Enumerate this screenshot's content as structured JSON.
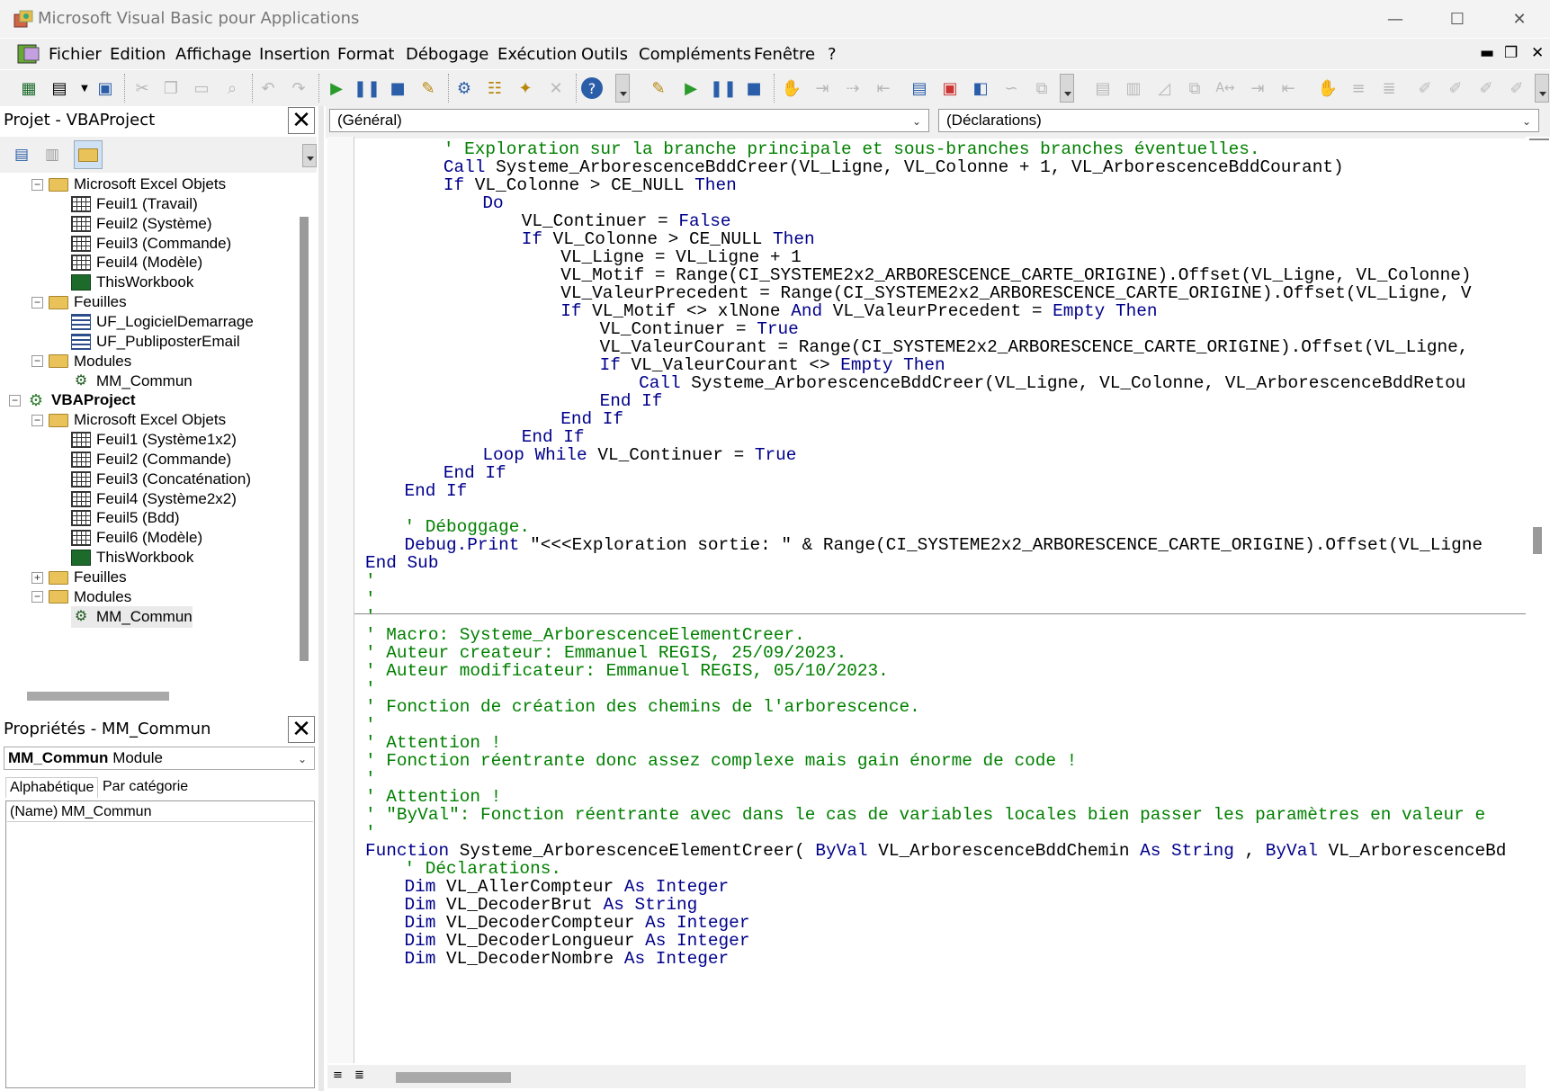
{
  "window": {
    "title": "Microsoft Visual Basic pour Applications",
    "minimize": "—",
    "maximize": "☐",
    "close": "✕"
  },
  "menu": {
    "items": [
      "Fichier",
      "Edition",
      "Affichage",
      "Insertion",
      "Format",
      "Débogage",
      "Exécution",
      "Outils",
      "Compléments",
      "Fenêtre",
      "?"
    ],
    "mdi_min": "▬",
    "mdi_restore": "❐",
    "mdi_close": "✕"
  },
  "project": {
    "title": "Projet - VBAProject",
    "close": "✕",
    "rows": [
      {
        "label": "Microsoft Excel Objets",
        "icon": "folder-icon",
        "level": 1,
        "exp": "−"
      },
      {
        "label": "Feuil1 (Travail)",
        "icon": "sheet-icon",
        "level": 2
      },
      {
        "label": "Feuil2 (Système)",
        "icon": "sheet-icon",
        "level": 2
      },
      {
        "label": "Feuil3 (Commande)",
        "icon": "sheet-icon",
        "level": 2
      },
      {
        "label": "Feuil4 (Modèle)",
        "icon": "sheet-icon",
        "level": 2
      },
      {
        "label": "ThisWorkbook",
        "icon": "workbook-icon",
        "level": 2
      },
      {
        "label": "Feuilles",
        "icon": "folder-icon",
        "level": 1,
        "exp": "−"
      },
      {
        "label": "UF_LogicielDemarrage",
        "icon": "form-icon",
        "level": 2
      },
      {
        "label": "UF_PubliposterEmail",
        "icon": "form-icon",
        "level": 2
      },
      {
        "label": "Modules",
        "icon": "folder-icon",
        "level": 1,
        "exp": "−"
      },
      {
        "label": "MM_Commun",
        "icon": "module-icon",
        "level": 2
      },
      {
        "label": "VBAProject",
        "icon": "project-icon",
        "level": 0,
        "exp": "−",
        "bold": true
      },
      {
        "label": "Microsoft Excel Objets",
        "icon": "folder-icon",
        "level": 1,
        "exp": "−"
      },
      {
        "label": "Feuil1 (Système1x2)",
        "icon": "sheet-icon",
        "level": 2
      },
      {
        "label": "Feuil2 (Commande)",
        "icon": "sheet-icon",
        "level": 2
      },
      {
        "label": "Feuil3 (Concaténation)",
        "icon": "sheet-icon",
        "level": 2
      },
      {
        "label": "Feuil4 (Système2x2)",
        "icon": "sheet-icon",
        "level": 2
      },
      {
        "label": "Feuil5 (Bdd)",
        "icon": "sheet-icon",
        "level": 2
      },
      {
        "label": "Feuil6 (Modèle)",
        "icon": "sheet-icon",
        "level": 2
      },
      {
        "label": "ThisWorkbook",
        "icon": "workbook-icon",
        "level": 2
      },
      {
        "label": "Feuilles",
        "icon": "folder-icon",
        "level": 1,
        "exp": "+"
      },
      {
        "label": "Modules",
        "icon": "folder-icon",
        "level": 1,
        "exp": "−"
      },
      {
        "label": "MM_Commun",
        "icon": "module-icon",
        "level": 2,
        "selected": true
      }
    ]
  },
  "properties": {
    "title": "Propriétés - MM_Commun",
    "close": "✕",
    "object_name": "MM_Commun",
    "object_type": "Module",
    "tab_alpha": "Alphabétique",
    "tab_cat": "Par catégorie",
    "prop_name": "(Name)",
    "prop_value": "MM_Commun"
  },
  "code": {
    "object_combo": "(Général)",
    "proc_combo": "(Déclarations)",
    "lines": [
      {
        "i": 8,
        "s": [
          [
            "cm",
            "' Exploration sur la branche principale et sous-branches branches éventuelles."
          ]
        ]
      },
      {
        "i": 8,
        "s": [
          [
            "kw",
            "Call"
          ],
          [
            "",
            "Systeme_ArborescenceBddCreer(VL_Ligne, VL_Colonne + 1, VL_ArborescenceBddCourant)"
          ]
        ]
      },
      {
        "i": 8,
        "s": [
          [
            "kw",
            "If"
          ],
          [
            "",
            "VL_Colonne > CE_NULL"
          ],
          [
            "kw",
            "Then"
          ]
        ]
      },
      {
        "i": 12,
        "s": [
          [
            "kw",
            "Do"
          ]
        ]
      },
      {
        "i": 16,
        "s": [
          [
            "",
            "VL_Continuer ="
          ],
          [
            "kw",
            "False"
          ]
        ]
      },
      {
        "i": 16,
        "s": [
          [
            "kw",
            "If"
          ],
          [
            "",
            "VL_Colonne > CE_NULL"
          ],
          [
            "kw",
            "Then"
          ]
        ]
      },
      {
        "i": 20,
        "s": [
          [
            "",
            "VL_Ligne = VL_Ligne + 1"
          ]
        ]
      },
      {
        "i": 20,
        "s": [
          [
            "",
            "VL_Motif = Range(CI_SYSTEME2x2_ARBORESCENCE_CARTE_ORIGINE).Offset(VL_Ligne, VL_Colonne)"
          ]
        ]
      },
      {
        "i": 20,
        "s": [
          [
            "",
            "VL_ValeurPrecedent = Range(CI_SYSTEME2x2_ARBORESCENCE_CARTE_ORIGINE).Offset(VL_Ligne, V"
          ]
        ]
      },
      {
        "i": 20,
        "s": [
          [
            "kw",
            "If"
          ],
          [
            "",
            "VL_Motif <> xlNone"
          ],
          [
            "kw",
            "And"
          ],
          [
            "",
            "VL_ValeurPrecedent ="
          ],
          [
            "kw",
            "Empty Then"
          ]
        ]
      },
      {
        "i": 24,
        "s": [
          [
            "",
            "VL_Continuer ="
          ],
          [
            "kw",
            "True"
          ]
        ]
      },
      {
        "i": 24,
        "s": [
          [
            "",
            "VL_ValeurCourant = Range(CI_SYSTEME2x2_ARBORESCENCE_CARTE_ORIGINE).Offset(VL_Ligne,"
          ]
        ]
      },
      {
        "i": 24,
        "s": [
          [
            "kw",
            "If"
          ],
          [
            "",
            "VL_ValeurCourant <>"
          ],
          [
            "kw",
            "Empty Then"
          ]
        ]
      },
      {
        "i": 28,
        "s": [
          [
            "kw",
            "Call"
          ],
          [
            "",
            "Systeme_ArborescenceBddCreer(VL_Ligne, VL_Colonne, VL_ArborescenceBddRetou"
          ]
        ]
      },
      {
        "i": 24,
        "s": [
          [
            "kw",
            "End If"
          ]
        ]
      },
      {
        "i": 20,
        "s": [
          [
            "kw",
            "End If"
          ]
        ]
      },
      {
        "i": 16,
        "s": [
          [
            "kw",
            "End If"
          ]
        ]
      },
      {
        "i": 12,
        "s": [
          [
            "kw",
            "Loop While"
          ],
          [
            "",
            "VL_Continuer ="
          ],
          [
            "kw",
            "True"
          ]
        ]
      },
      {
        "i": 8,
        "s": [
          [
            "kw",
            "End If"
          ]
        ]
      },
      {
        "i": 4,
        "s": [
          [
            "kw",
            "End If"
          ]
        ]
      },
      {
        "i": 0,
        "s": []
      },
      {
        "i": 4,
        "s": [
          [
            "cm",
            "' Déboggage."
          ]
        ]
      },
      {
        "i": 4,
        "s": [
          [
            "kw",
            "Debug.Print"
          ],
          [
            "",
            "\"<<<Exploration sortie: \" & Range(CI_SYSTEME2x2_ARBORESCENCE_CARTE_ORIGINE).Offset(VL_Ligne"
          ]
        ]
      },
      {
        "i": 0,
        "s": [
          [
            "kw",
            "End Sub"
          ]
        ]
      },
      {
        "i": 0,
        "s": [
          [
            "cm",
            "'"
          ]
        ]
      },
      {
        "i": 0,
        "s": [
          [
            "cm",
            "'"
          ]
        ]
      },
      {
        "i": 0,
        "s": [
          [
            "cm",
            "'"
          ]
        ]
      },
      {
        "i": 0,
        "s": [
          [
            "cm",
            "' Macro: Systeme_ArborescenceElementCreer."
          ]
        ]
      },
      {
        "i": 0,
        "s": [
          [
            "cm",
            "' Auteur createur: Emmanuel REGIS, 25/09/2023."
          ]
        ]
      },
      {
        "i": 0,
        "s": [
          [
            "cm",
            "' Auteur modificateur: Emmanuel REGIS, 05/10/2023."
          ]
        ]
      },
      {
        "i": 0,
        "s": [
          [
            "cm",
            "'"
          ]
        ]
      },
      {
        "i": 0,
        "s": [
          [
            "cm",
            "' Fonction de création des chemins de l'arborescence."
          ]
        ]
      },
      {
        "i": 0,
        "s": [
          [
            "cm",
            "'"
          ]
        ]
      },
      {
        "i": 0,
        "s": [
          [
            "cm",
            "' Attention !"
          ]
        ]
      },
      {
        "i": 0,
        "s": [
          [
            "cm",
            "' Fonction réentrante donc assez complexe mais gain énorme de code !"
          ]
        ]
      },
      {
        "i": 0,
        "s": [
          [
            "cm",
            "'"
          ]
        ]
      },
      {
        "i": 0,
        "s": [
          [
            "cm",
            "' Attention !"
          ]
        ]
      },
      {
        "i": 0,
        "s": [
          [
            "cm",
            "' \"ByVal\": Fonction réentrante avec dans le cas de variables locales bien passer les paramètres en valeur e"
          ]
        ]
      },
      {
        "i": 0,
        "s": [
          [
            "cm",
            "'"
          ]
        ]
      },
      {
        "i": 0,
        "s": [
          [
            "kw",
            "Function"
          ],
          [
            "",
            "Systeme_ArborescenceElementCreer("
          ],
          [
            "kw",
            "ByVal"
          ],
          [
            "",
            "VL_ArborescenceBddChemin"
          ],
          [
            "kw",
            "As String"
          ],
          [
            "",
            ","
          ],
          [
            "kw",
            "ByVal"
          ],
          [
            "",
            "VL_ArborescenceBd"
          ]
        ]
      },
      {
        "i": 4,
        "s": [
          [
            "cm",
            "' Déclarations."
          ]
        ]
      },
      {
        "i": 4,
        "s": [
          [
            "kw",
            "Dim"
          ],
          [
            "",
            "VL_AllerCompteur"
          ],
          [
            "kw",
            "As Integer"
          ]
        ]
      },
      {
        "i": 4,
        "s": [
          [
            "kw",
            "Dim"
          ],
          [
            "",
            "VL_DecoderBrut"
          ],
          [
            "kw",
            "As String"
          ]
        ]
      },
      {
        "i": 4,
        "s": [
          [
            "kw",
            "Dim"
          ],
          [
            "",
            "VL_DecoderCompteur"
          ],
          [
            "kw",
            "As Integer"
          ]
        ]
      },
      {
        "i": 4,
        "s": [
          [
            "kw",
            "Dim"
          ],
          [
            "",
            "VL_DecoderLongueur"
          ],
          [
            "kw",
            "As Integer"
          ]
        ]
      },
      {
        "i": 4,
        "s": [
          [
            "kw",
            "Dim"
          ],
          [
            "",
            "VL_DecoderNombre"
          ],
          [
            "kw",
            "As Integer"
          ]
        ]
      }
    ]
  },
  "colors": {
    "keyword": "#00008b",
    "comment": "#008000",
    "text": "#000000"
  }
}
